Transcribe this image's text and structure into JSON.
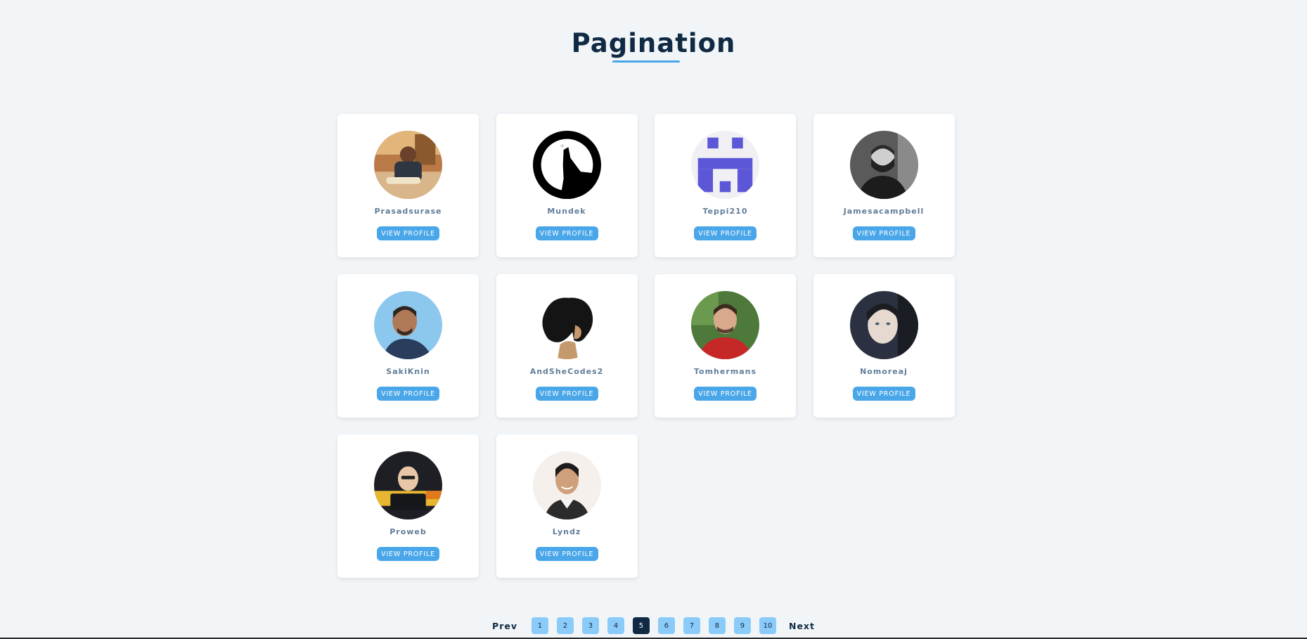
{
  "header": {
    "title": "Pagination"
  },
  "colors": {
    "background": "#f1f5f8",
    "accent": "#49a6e9",
    "page_button": "#8bcbf9",
    "active_page": "#102a43",
    "username": "#617d98"
  },
  "profiles": [
    {
      "username": "Prasadsurase",
      "button_label": "VIEW PROFILE",
      "avatar_icon": "avatar-photo"
    },
    {
      "username": "Mundek",
      "button_label": "VIEW PROFILE",
      "avatar_icon": "avatar-logo"
    },
    {
      "username": "Teppi210",
      "button_label": "VIEW PROFILE",
      "avatar_icon": "avatar-identicon"
    },
    {
      "username": "Jamesacampbell",
      "button_label": "VIEW PROFILE",
      "avatar_icon": "avatar-photo"
    },
    {
      "username": "SakiKnin",
      "button_label": "VIEW PROFILE",
      "avatar_icon": "avatar-photo"
    },
    {
      "username": "AndSheCodes2",
      "button_label": "VIEW PROFILE",
      "avatar_icon": "avatar-illustration"
    },
    {
      "username": "Tomhermans",
      "button_label": "VIEW PROFILE",
      "avatar_icon": "avatar-photo"
    },
    {
      "username": "Nomoreaj",
      "button_label": "VIEW PROFILE",
      "avatar_icon": "avatar-photo"
    },
    {
      "username": "Proweb",
      "button_label": "VIEW PROFILE",
      "avatar_icon": "avatar-photo"
    },
    {
      "username": "Lyndz",
      "button_label": "VIEW PROFILE",
      "avatar_icon": "avatar-photo"
    }
  ],
  "pagination": {
    "prev_label": "Prev",
    "next_label": "Next",
    "pages": [
      "1",
      "2",
      "3",
      "4",
      "5",
      "6",
      "7",
      "8",
      "9",
      "10"
    ],
    "current_page": "5"
  }
}
